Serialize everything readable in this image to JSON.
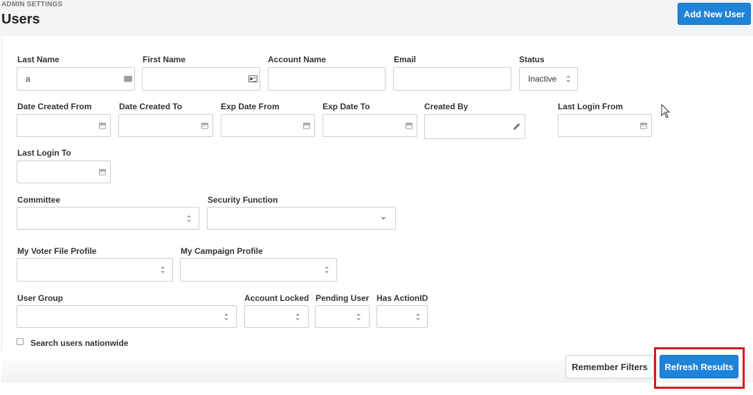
{
  "header": {
    "eyebrow": "ADMIN SETTINGS",
    "title": "Users",
    "add_button": "Add New User"
  },
  "filters": {
    "last_name": {
      "label": "Last Name",
      "value": "a"
    },
    "first_name": {
      "label": "First Name",
      "value": ""
    },
    "account_name": {
      "label": "Account Name",
      "value": ""
    },
    "email": {
      "label": "Email",
      "value": ""
    },
    "status": {
      "label": "Status",
      "value": "Inactive"
    },
    "date_created_from": {
      "label": "Date Created From",
      "value": ""
    },
    "date_created_to": {
      "label": "Date Created To",
      "value": ""
    },
    "exp_date_from": {
      "label": "Exp Date From",
      "value": ""
    },
    "exp_date_to": {
      "label": "Exp Date To",
      "value": ""
    },
    "created_by": {
      "label": "Created By",
      "value": ""
    },
    "last_login_from": {
      "label": "Last Login From",
      "value": ""
    },
    "last_login_to": {
      "label": "Last Login To",
      "value": ""
    },
    "committee": {
      "label": "Committee",
      "value": ""
    },
    "security_function": {
      "label": "Security Function",
      "value": ""
    },
    "voter_file_profile": {
      "label": "My Voter File Profile",
      "value": ""
    },
    "campaign_profile": {
      "label": "My Campaign Profile",
      "value": ""
    },
    "user_group": {
      "label": "User Group",
      "value": ""
    },
    "account_locked": {
      "label": "Account Locked",
      "value": ""
    },
    "pending_user": {
      "label": "Pending User",
      "value": ""
    },
    "has_actionid": {
      "label": "Has ActionID",
      "value": ""
    },
    "nationwide": {
      "label": "Search users nationwide",
      "checked": false
    }
  },
  "footer": {
    "remember_button": "Remember Filters",
    "refresh_button": "Refresh Results"
  },
  "colors": {
    "primary": "#1f83d9",
    "highlight": "#e0121a"
  }
}
